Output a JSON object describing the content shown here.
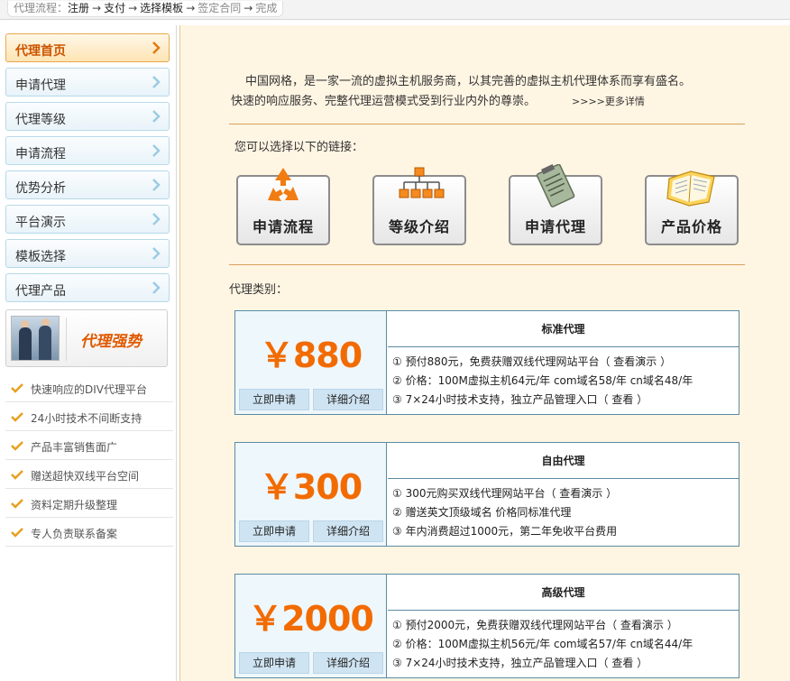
{
  "topbar": {
    "label": "代理流程：",
    "steps": [
      "注册",
      "支付",
      "选择模板",
      "签定合同",
      "完成"
    ]
  },
  "sidebar": {
    "items": [
      {
        "label": "代理首页",
        "active": true
      },
      {
        "label": "申请代理",
        "active": false
      },
      {
        "label": "代理等级",
        "active": false
      },
      {
        "label": "申请流程",
        "active": false
      },
      {
        "label": "优势分析",
        "active": false
      },
      {
        "label": "平台演示",
        "active": false
      },
      {
        "label": "模板选择",
        "active": false
      },
      {
        "label": "代理产品",
        "active": false
      }
    ],
    "promo_text": "代理强势",
    "features": [
      "快速响应的DIV代理平台",
      "24小时技术不间断支持",
      "产品丰富销售面广",
      "赠送超快双线平台空间",
      "资料定期升级整理",
      "专人负责联系备案"
    ]
  },
  "main": {
    "intro_line1": "中国网格，是一家一流的虚拟主机服务商，以其完善的虚拟主机代理体系而享有盛名。",
    "intro_line2": "快速的响应服务、完整代理运营模式受到行业内外的尊崇。",
    "more_link": ">>>>更多详情",
    "link_hint": "您可以选择以下的链接：",
    "quick_links": [
      {
        "label": "申请流程",
        "icon": "recycle-icon"
      },
      {
        "label": "等级介绍",
        "icon": "hierarchy-icon"
      },
      {
        "label": "申请代理",
        "icon": "clipboard-icon"
      },
      {
        "label": "产品价格",
        "icon": "notebook-icon"
      }
    ],
    "category_label": "代理类别：",
    "plans": [
      {
        "price": "￥880",
        "title": "标准代理",
        "apply": "立即申请",
        "detail": "详细介绍",
        "lines": [
          "① 预付880元，免费获赠双线代理网站平台（ 查看演示 ）",
          "② 价格：100M虚拟主机64元/年  com域名58/年  cn域名48/年",
          "③ 7×24小时技术支持，独立产品管理入口（ 查看 ）"
        ]
      },
      {
        "price": "￥300",
        "title": "自由代理",
        "apply": "立即申请",
        "detail": "详细介绍",
        "lines": [
          "① 300元购买双线代理网站平台（ 查看演示 ）",
          "② 赠送英文顶级域名  价格同标准代理",
          "③ 年内消费超过1000元，第二年免收平台费用"
        ]
      },
      {
        "price": "￥2000",
        "title": "高级代理",
        "apply": "立即申请",
        "detail": "详细介绍",
        "lines": [
          "① 预付2000元，免费获赠双线代理网站平台（ 查看演示 ）",
          "② 价格：100M虚拟主机56元/年  com域名57/年  cn域名44/年",
          "③ 7×24小时技术支持，独立产品管理入口（ 查看 ）"
        ]
      }
    ]
  },
  "colors": {
    "accent_orange": "#f26b00",
    "content_bg": "#fff5e3",
    "border_blue": "#5b8ba3"
  }
}
